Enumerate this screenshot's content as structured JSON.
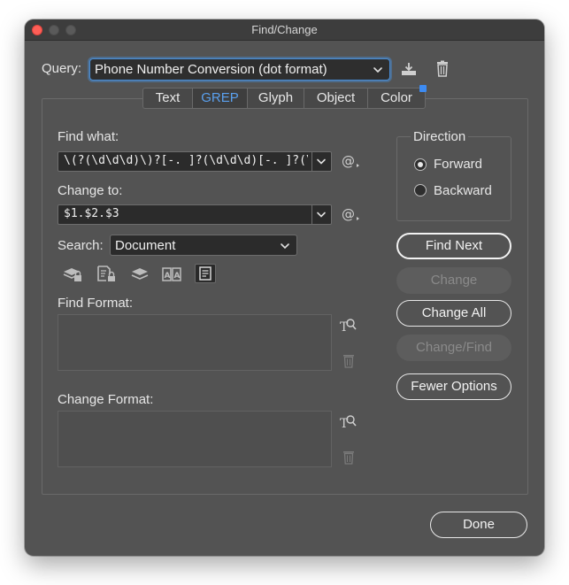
{
  "window": {
    "title": "Find/Change"
  },
  "query": {
    "label": "Query:",
    "selected": "Phone Number Conversion (dot format)",
    "save_icon": "save-query-icon",
    "delete_icon": "trash-icon"
  },
  "tabs": [
    {
      "label": "Text"
    },
    {
      "label": "GREP"
    },
    {
      "label": "Glyph"
    },
    {
      "label": "Object"
    },
    {
      "label": "Color"
    }
  ],
  "find": {
    "label": "Find what:",
    "value": "\\(?(\\d\\d\\d)\\)?[-. ]?(\\d\\d\\d)[-. ]?(\\d\\d\\d\\d)"
  },
  "change": {
    "label": "Change to:",
    "value": "$1.$2.$3"
  },
  "search": {
    "label": "Search:",
    "selected": "Document"
  },
  "search_options": [
    {
      "icon": "locked-layers-icon",
      "on": false
    },
    {
      "icon": "locked-stories-icon",
      "on": false
    },
    {
      "icon": "hidden-layers-icon",
      "on": false
    },
    {
      "icon": "master-pages-icon",
      "on": false
    },
    {
      "icon": "footnotes-icon",
      "on": true
    }
  ],
  "find_format": {
    "label": "Find Format:"
  },
  "change_format": {
    "label": "Change Format:"
  },
  "direction": {
    "label": "Direction",
    "options": [
      {
        "label": "Forward",
        "selected": true
      },
      {
        "label": "Backward",
        "selected": false
      }
    ]
  },
  "buttons": {
    "find_next": "Find Next",
    "change": "Change",
    "change_all": "Change All",
    "change_find": "Change/Find",
    "fewer_options": "Fewer Options",
    "done": "Done"
  },
  "colors": {
    "accent": "#4a8fd8",
    "active_tab_text": "#5aa0ee",
    "panel_bg": "#535353",
    "close_button": "#fe5f57"
  }
}
